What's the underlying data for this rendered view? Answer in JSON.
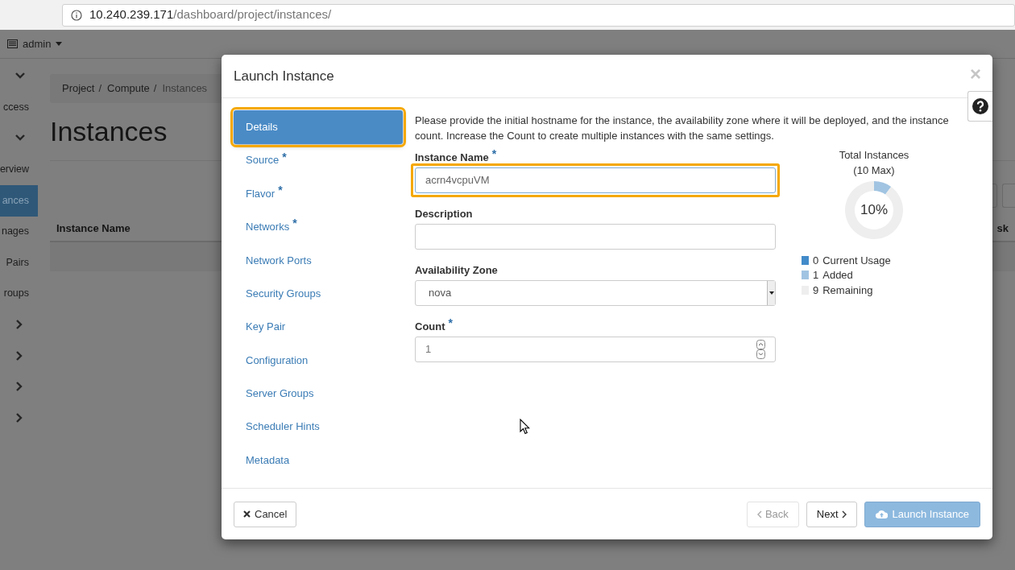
{
  "address_bar": {
    "host": "10.240.239.171",
    "path": "/dashboard/project/instances/"
  },
  "top_nav": {
    "user_menu": "admin"
  },
  "sidebar": {
    "items": [
      {
        "kind": "chevron_down"
      },
      {
        "kind": "link",
        "label": "ccess",
        "selected": false
      },
      {
        "kind": "chevron_down"
      },
      {
        "kind": "link",
        "label": "erview",
        "selected": false
      },
      {
        "kind": "link",
        "label": "ances",
        "selected": true
      },
      {
        "kind": "link",
        "label": "nages",
        "selected": false
      },
      {
        "kind": "link",
        "label": "Pairs",
        "selected": false
      },
      {
        "kind": "link",
        "label": "roups",
        "selected": false
      },
      {
        "kind": "chevron_right"
      },
      {
        "kind": "chevron_right"
      },
      {
        "kind": "chevron_right"
      },
      {
        "kind": "chevron_right"
      }
    ]
  },
  "breadcrumb": [
    {
      "label": "Project",
      "separator": "/"
    },
    {
      "label": "Compute",
      "separator": "/"
    },
    {
      "label": "Instances"
    }
  ],
  "page_title": "Instances",
  "table": {
    "columns": [
      "Instance Name",
      "sk"
    ]
  },
  "modal": {
    "title": "Launch Instance",
    "close": "×",
    "steps": [
      {
        "label": "Details",
        "selected": true,
        "highlighted": true
      },
      {
        "label": "Source",
        "required_mark": "*",
        "selected": false,
        "highlighted": false
      },
      {
        "label": "Flavor",
        "required_mark": "*",
        "selected": false,
        "highlighted": false
      },
      {
        "label": "Networks",
        "required_mark": "*",
        "selected": false,
        "highlighted": false
      },
      {
        "label": "Network Ports",
        "selected": false,
        "highlighted": false
      },
      {
        "label": "Security Groups",
        "selected": false,
        "highlighted": false
      },
      {
        "label": "Key Pair",
        "selected": false,
        "highlighted": false
      },
      {
        "label": "Configuration",
        "selected": false,
        "highlighted": false
      },
      {
        "label": "Server Groups",
        "selected": false,
        "highlighted": false
      },
      {
        "label": "Scheduler Hints",
        "selected": false,
        "highlighted": false
      },
      {
        "label": "Metadata",
        "selected": false,
        "highlighted": false
      }
    ],
    "intro": "Please provide the initial hostname for the instance, the availability zone where it will be deployed, and the instance count. Increase the Count to create multiple instances with the same settings.",
    "fields": [
      {
        "kind": "text",
        "label": "Instance Name",
        "required_mark": "*",
        "value": "acrn4vcpuVM",
        "highlighted": true
      },
      {
        "kind": "text",
        "label": "Description",
        "highlighted": false
      },
      {
        "kind": "select",
        "label": "Availability Zone",
        "value": "nova",
        "highlighted": false
      },
      {
        "kind": "number",
        "label": "Count",
        "required_mark": "*",
        "value": "1",
        "highlighted": false
      }
    ],
    "quota": {
      "title": "Total Instances",
      "subtitle": "(10 Max)",
      "center_label": "10%",
      "legend": [
        {
          "count": "0",
          "color": "#428bca"
        },
        {
          "count": "1",
          "color": "#a1c4e2"
        },
        {
          "count": "9",
          "color": "#eeeeee"
        }
      ],
      "chart_data": {
        "type": "donut",
        "categories": [
          "Current Usage",
          "Added",
          "Remaining"
        ],
        "values": [
          0,
          10,
          90
        ]
      }
    },
    "footer": {
      "cancel": "Cancel",
      "buttons": [
        {
          "kind": "back",
          "label": "Back",
          "disabled": true
        },
        {
          "kind": "next",
          "label": "Next",
          "disabled": false
        },
        {
          "kind": "launch",
          "label": "Launch Instance",
          "disabled": true
        }
      ]
    }
  }
}
